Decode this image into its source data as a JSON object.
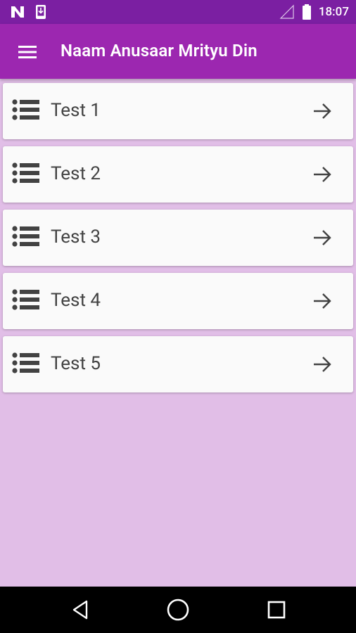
{
  "status_bar": {
    "time": "18:07",
    "icons": [
      "n-notification-icon",
      "download-notification-icon",
      "signal-icon",
      "battery-icon"
    ]
  },
  "app_bar": {
    "title": "Naam Anusaar Mrityu Din",
    "menu_icon": "hamburger-menu-icon"
  },
  "list": {
    "items": [
      {
        "label": "Test 1"
      },
      {
        "label": "Test 2"
      },
      {
        "label": "Test 3"
      },
      {
        "label": "Test 4"
      },
      {
        "label": "Test 5"
      }
    ]
  },
  "nav_bar": {
    "buttons": [
      "back-icon",
      "home-icon",
      "recents-icon"
    ]
  },
  "colors": {
    "status_bar": "#7b1fa2",
    "app_bar": "#9c27b0",
    "background": "#e1bee7",
    "card": "#fafafa"
  }
}
